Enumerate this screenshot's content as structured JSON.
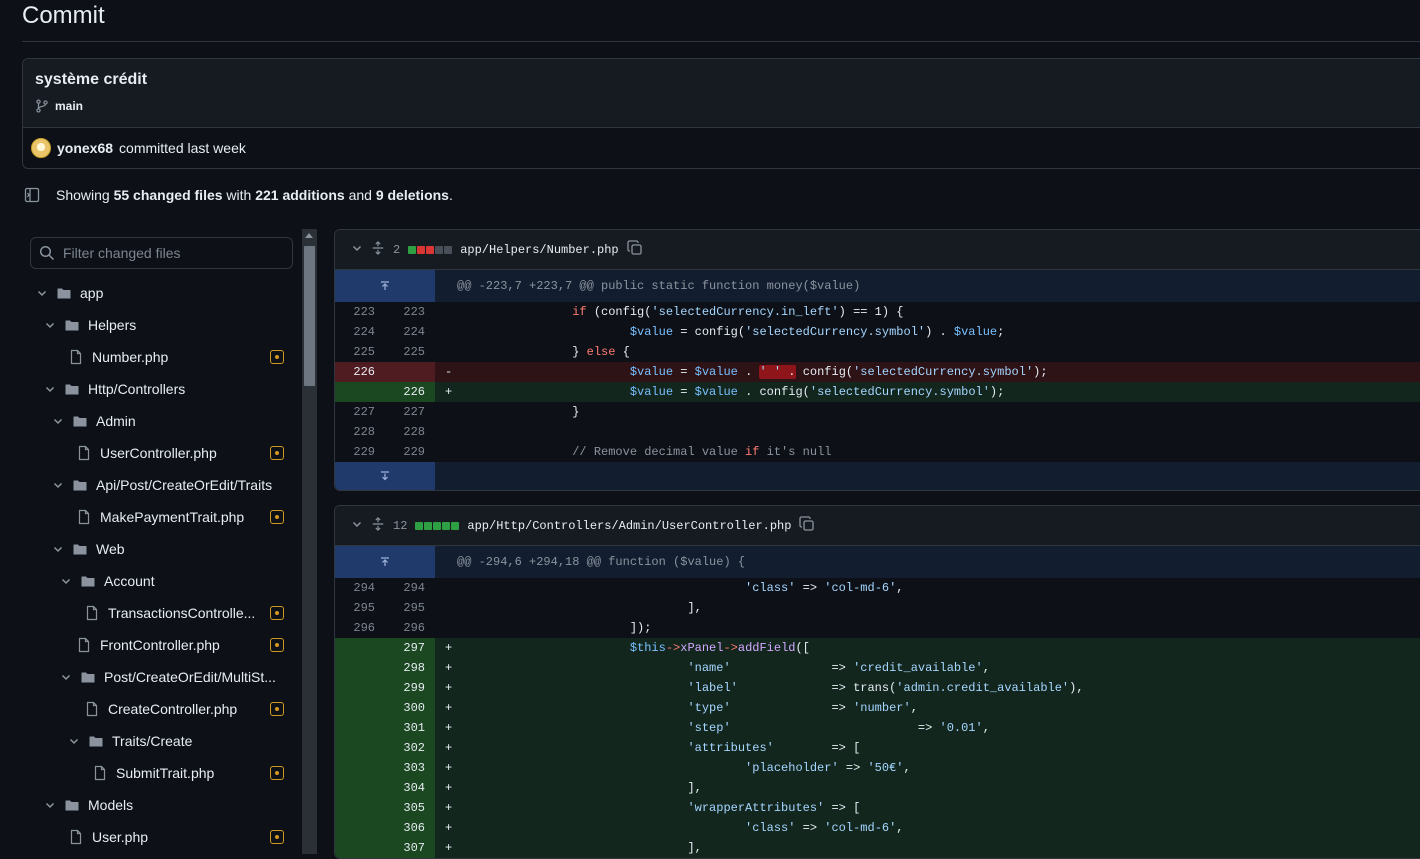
{
  "page": {
    "title": "Commit"
  },
  "commit": {
    "message": "système crédit",
    "branch": "main",
    "author": "yonex68",
    "meta": "committed last week"
  },
  "summary": {
    "prefix": "Showing",
    "files": "55 changed files",
    "with": "with",
    "additions": "221 additions",
    "and": "and",
    "deletions": "9 deletions",
    "suffix": "."
  },
  "filter": {
    "placeholder": "Filter changed files"
  },
  "tree": [
    {
      "label": "app",
      "type": "folder",
      "depth": 0,
      "modified": false
    },
    {
      "label": "Helpers",
      "type": "folder",
      "depth": 1,
      "modified": false
    },
    {
      "label": "Number.php",
      "type": "file",
      "depth": 2,
      "modified": true
    },
    {
      "label": "Http/Controllers",
      "type": "folder",
      "depth": 1,
      "modified": false
    },
    {
      "label": "Admin",
      "type": "folder",
      "depth": 2,
      "modified": false
    },
    {
      "label": "UserController.php",
      "type": "file",
      "depth": 3,
      "modified": true
    },
    {
      "label": "Api/Post/CreateOrEdit/Traits",
      "type": "folder",
      "depth": 2,
      "modified": false
    },
    {
      "label": "MakePaymentTrait.php",
      "type": "file",
      "depth": 3,
      "modified": true
    },
    {
      "label": "Web",
      "type": "folder",
      "depth": 2,
      "modified": false
    },
    {
      "label": "Account",
      "type": "folder",
      "depth": 3,
      "modified": false
    },
    {
      "label": "TransactionsControlle...",
      "type": "file",
      "depth": 4,
      "modified": true
    },
    {
      "label": "FrontController.php",
      "type": "file",
      "depth": 3,
      "modified": true
    },
    {
      "label": "Post/CreateOrEdit/MultiSt...",
      "type": "folder",
      "depth": 3,
      "modified": false
    },
    {
      "label": "CreateController.php",
      "type": "file",
      "depth": 4,
      "modified": true
    },
    {
      "label": "Traits/Create",
      "type": "folder",
      "depth": 4,
      "modified": false
    },
    {
      "label": "SubmitTrait.php",
      "type": "file",
      "depth": 5,
      "modified": true
    },
    {
      "label": "Models",
      "type": "folder",
      "depth": 1,
      "modified": false
    },
    {
      "label": "User.php",
      "type": "file",
      "depth": 2,
      "modified": true
    }
  ],
  "diffs": [
    {
      "count": "2",
      "blocks": [
        "add",
        "del",
        "del",
        "neu",
        "neu"
      ],
      "path": "app/Helpers/Number.php",
      "hunk": "@@ -223,7 +223,7 @@ public static function money($value)",
      "lines": [
        {
          "kind": "ctx",
          "l": "223",
          "r": "223",
          "code": "                if (config('selectedCurrency.in_left') == 1) {"
        },
        {
          "kind": "ctx",
          "l": "224",
          "r": "224",
          "code": "                        $value = config('selectedCurrency.symbol') . $value;"
        },
        {
          "kind": "ctx",
          "l": "225",
          "r": "225",
          "code": "                } else {"
        },
        {
          "kind": "del",
          "l": "226",
          "r": "",
          "sign": "-",
          "code": "                        $value = $value . ' ' . config('selectedCurrency.symbol');"
        },
        {
          "kind": "add",
          "l": "",
          "r": "226",
          "sign": "+",
          "code": "                        $value = $value . config('selectedCurrency.symbol');"
        },
        {
          "kind": "ctx",
          "l": "227",
          "r": "227",
          "code": "                }"
        },
        {
          "kind": "ctx",
          "l": "228",
          "r": "228",
          "code": ""
        },
        {
          "kind": "ctx",
          "l": "229",
          "r": "229",
          "code": "                // Remove decimal value if it's null"
        }
      ]
    },
    {
      "count": "12",
      "blocks": [
        "add",
        "add",
        "add",
        "add",
        "add"
      ],
      "path": "app/Http/Controllers/Admin/UserController.php",
      "hunk": "@@ -294,6 +294,18 @@ function ($value) {",
      "lines": [
        {
          "kind": "ctx",
          "l": "294",
          "r": "294",
          "code": "                                        'class' => 'col-md-6',"
        },
        {
          "kind": "ctx",
          "l": "295",
          "r": "295",
          "code": "                                ],"
        },
        {
          "kind": "ctx",
          "l": "296",
          "r": "296",
          "code": "                        ]);"
        },
        {
          "kind": "add",
          "l": "",
          "r": "297",
          "sign": "+",
          "code": "                        $this->xPanel->addField(["
        },
        {
          "kind": "add",
          "l": "",
          "r": "298",
          "sign": "+",
          "code": "                                'name'              => 'credit_available',"
        },
        {
          "kind": "add",
          "l": "",
          "r": "299",
          "sign": "+",
          "code": "                                'label'             => trans('admin.credit_available'),"
        },
        {
          "kind": "add",
          "l": "",
          "r": "300",
          "sign": "+",
          "code": "                                'type'              => 'number',"
        },
        {
          "kind": "add",
          "l": "",
          "r": "301",
          "sign": "+",
          "code": "                                'step'                          => '0.01',"
        },
        {
          "kind": "add",
          "l": "",
          "r": "302",
          "sign": "+",
          "code": "                                'attributes'        => ["
        },
        {
          "kind": "add",
          "l": "",
          "r": "303",
          "sign": "+",
          "code": "                                        'placeholder' => '50€',"
        },
        {
          "kind": "add",
          "l": "",
          "r": "304",
          "sign": "+",
          "code": "                                ],"
        },
        {
          "kind": "add",
          "l": "",
          "r": "305",
          "sign": "+",
          "code": "                                'wrapperAttributes' => ["
        },
        {
          "kind": "add",
          "l": "",
          "r": "306",
          "sign": "+",
          "code": "                                        'class' => 'col-md-6',"
        },
        {
          "kind": "add",
          "l": "",
          "r": "307",
          "sign": "+",
          "code": "                                ],"
        }
      ]
    }
  ],
  "colors": {
    "added": "#2ea043",
    "deleted": "#da3633",
    "modified": "#d29922",
    "hunk": "#1f3a6b"
  }
}
